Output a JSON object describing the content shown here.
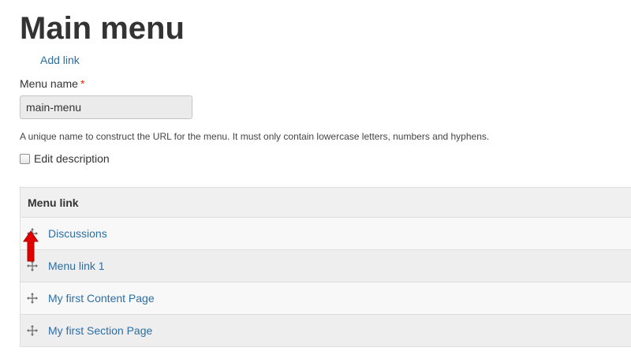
{
  "page": {
    "title": "Main menu"
  },
  "actions": {
    "add_link_label": "Add link"
  },
  "menu_name_field": {
    "label": "Menu name",
    "required_mark": "*",
    "value": "main-menu",
    "description": "A unique name to construct the URL for the menu. It must only contain lowercase letters, numbers and hyphens."
  },
  "edit_description": {
    "label": "Edit description",
    "checked": false
  },
  "menu_table": {
    "header": "Menu link",
    "rows": [
      {
        "label": "Discussions",
        "icon": "drag-handle-icon"
      },
      {
        "label": "Menu link 1",
        "icon": "drag-handle-icon"
      },
      {
        "label": "My first Content Page",
        "icon": "drag-handle-icon"
      },
      {
        "label": "My first Section Page",
        "icon": "drag-handle-icon"
      }
    ]
  },
  "colors": {
    "link": "#2a6ea6",
    "required": "#e32700",
    "annotation_arrow": "#e00000"
  }
}
